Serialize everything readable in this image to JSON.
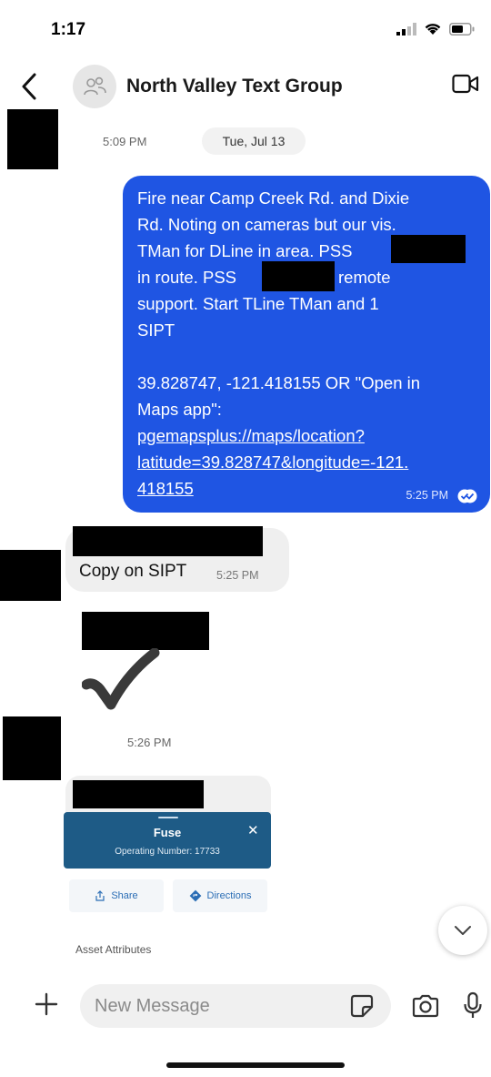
{
  "status_bar": {
    "time": "1:17"
  },
  "header": {
    "title": "North Valley Text Group"
  },
  "date_row": {
    "time": "5:09 PM",
    "date": "Tue, Jul 13"
  },
  "outgoing_message": {
    "lines": [
      "Fire near Camp Creek Rd.  and Dixie",
      "Rd.  Noting on cameras but our vis.",
      "TMan for DLine in area. PSS",
      "in route.  PSS",
      "remote",
      "support. Start TLine TMan and 1",
      "SIPT",
      "39.828747, -121.418155 OR \"Open in",
      "Maps app\":",
      "pgemapsplus://maps/location?",
      "latitude=39.828747&longitude=-121.",
      "418155"
    ],
    "time": "5:25 PM"
  },
  "incoming_message": {
    "text": "Copy on SIPT",
    "time": "5:25 PM"
  },
  "second_time": "5:26 PM",
  "fuse_card": {
    "title": "Fuse",
    "subtitle": "Operating Number: 17733",
    "share_label": "Share",
    "directions_label": "Directions",
    "asset_label": "Asset Attributes"
  },
  "composer": {
    "placeholder": "New Message"
  }
}
